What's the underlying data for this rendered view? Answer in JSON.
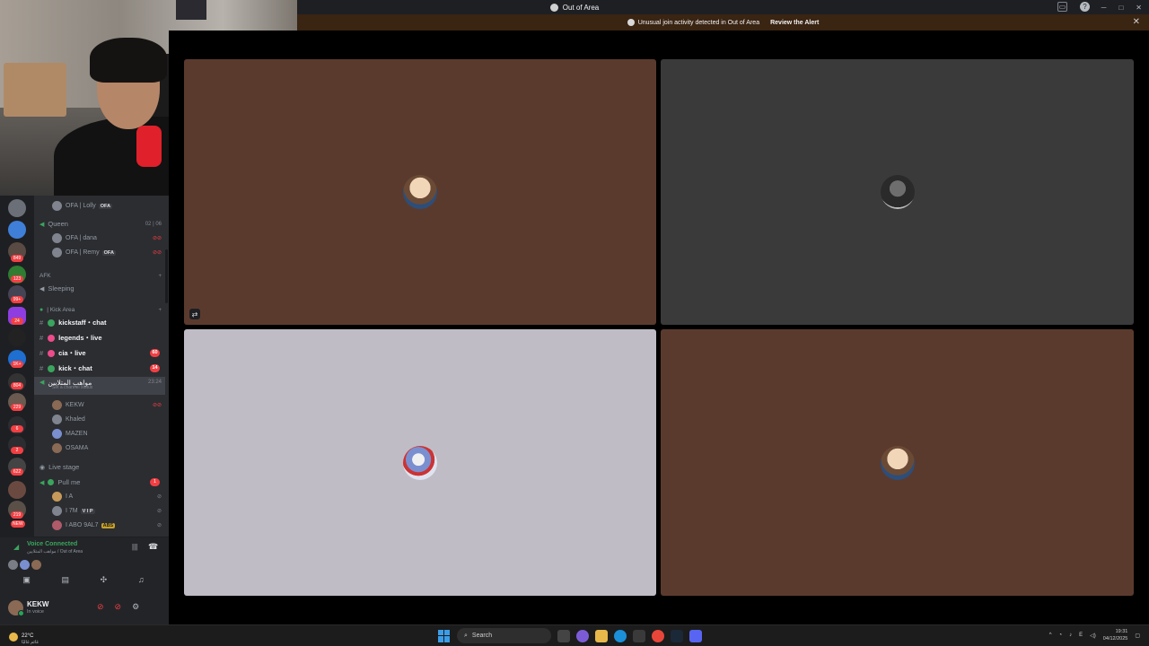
{
  "window": {
    "title": "Out of Area",
    "controls": [
      "─",
      "□",
      "✕"
    ],
    "icons": [
      "screen-share-icon",
      "help-icon"
    ]
  },
  "alert": {
    "message": "Unusual join activity detected in Out of Area",
    "link": "Review the Alert",
    "close": "✕"
  },
  "servers": {
    "badges": [
      "849",
      "123",
      "99+",
      "24",
      "1K+",
      "804",
      "229",
      "6",
      "2",
      "622",
      "219",
      "NEW"
    ]
  },
  "sidebar": {
    "top_user": {
      "name": "OFA | Lolly",
      "tag": "OFA"
    },
    "voice_queen": {
      "name": "Queen",
      "counter_left": "02",
      "counter_right": "06"
    },
    "queen_users": [
      {
        "name": "OFA | dana"
      },
      {
        "name": "OFA | Remy",
        "tag": "OFA"
      }
    ],
    "category_afk": "AFK",
    "voice_sleeping": "Sleeping",
    "category_kick": "| Kick Area",
    "text_channels": [
      {
        "name": "kickstaff・chat",
        "badge": ""
      },
      {
        "name": "legends・live",
        "badge": ""
      },
      {
        "name": "cia・live",
        "badge": "60"
      },
      {
        "name": "kick・chat",
        "badge": "14"
      }
    ],
    "active_voice": {
      "name": "مواهب المتلايين",
      "timer": "23:24",
      "sub": "Set a channel status"
    },
    "active_users": [
      {
        "name": "KEKW"
      },
      {
        "name": "Khaled"
      },
      {
        "name": "MAZEN"
      },
      {
        "name": "OSAMA"
      }
    ],
    "live_stage": "Live stage",
    "voice_pull": {
      "name": "Pull me",
      "badge": "1"
    },
    "pull_users": [
      {
        "name": "I A"
      },
      {
        "name": "I 7M",
        "tag": "V I P"
      },
      {
        "name": "I ABO 9AL7",
        "tag": "ABS"
      }
    ]
  },
  "voice_panel": {
    "status": "Voice Connected",
    "sub": "مواهب المتلايين / Out of Area"
  },
  "user_panel": {
    "name": "KEKW",
    "status": "In voice"
  },
  "taskbar": {
    "temp": "22°C",
    "weather_sub": "غائم غالبًا",
    "search": "Search",
    "time": "19:31",
    "date": "04/12/2025"
  },
  "colors": {
    "brown_tile": "#5b3a2e",
    "gray_tile": "#3a3a3a",
    "light_tile": "#c0bcc6",
    "alert_bg": "#3a2412",
    "online": "#23a55a",
    "mention": "#f23f43"
  }
}
